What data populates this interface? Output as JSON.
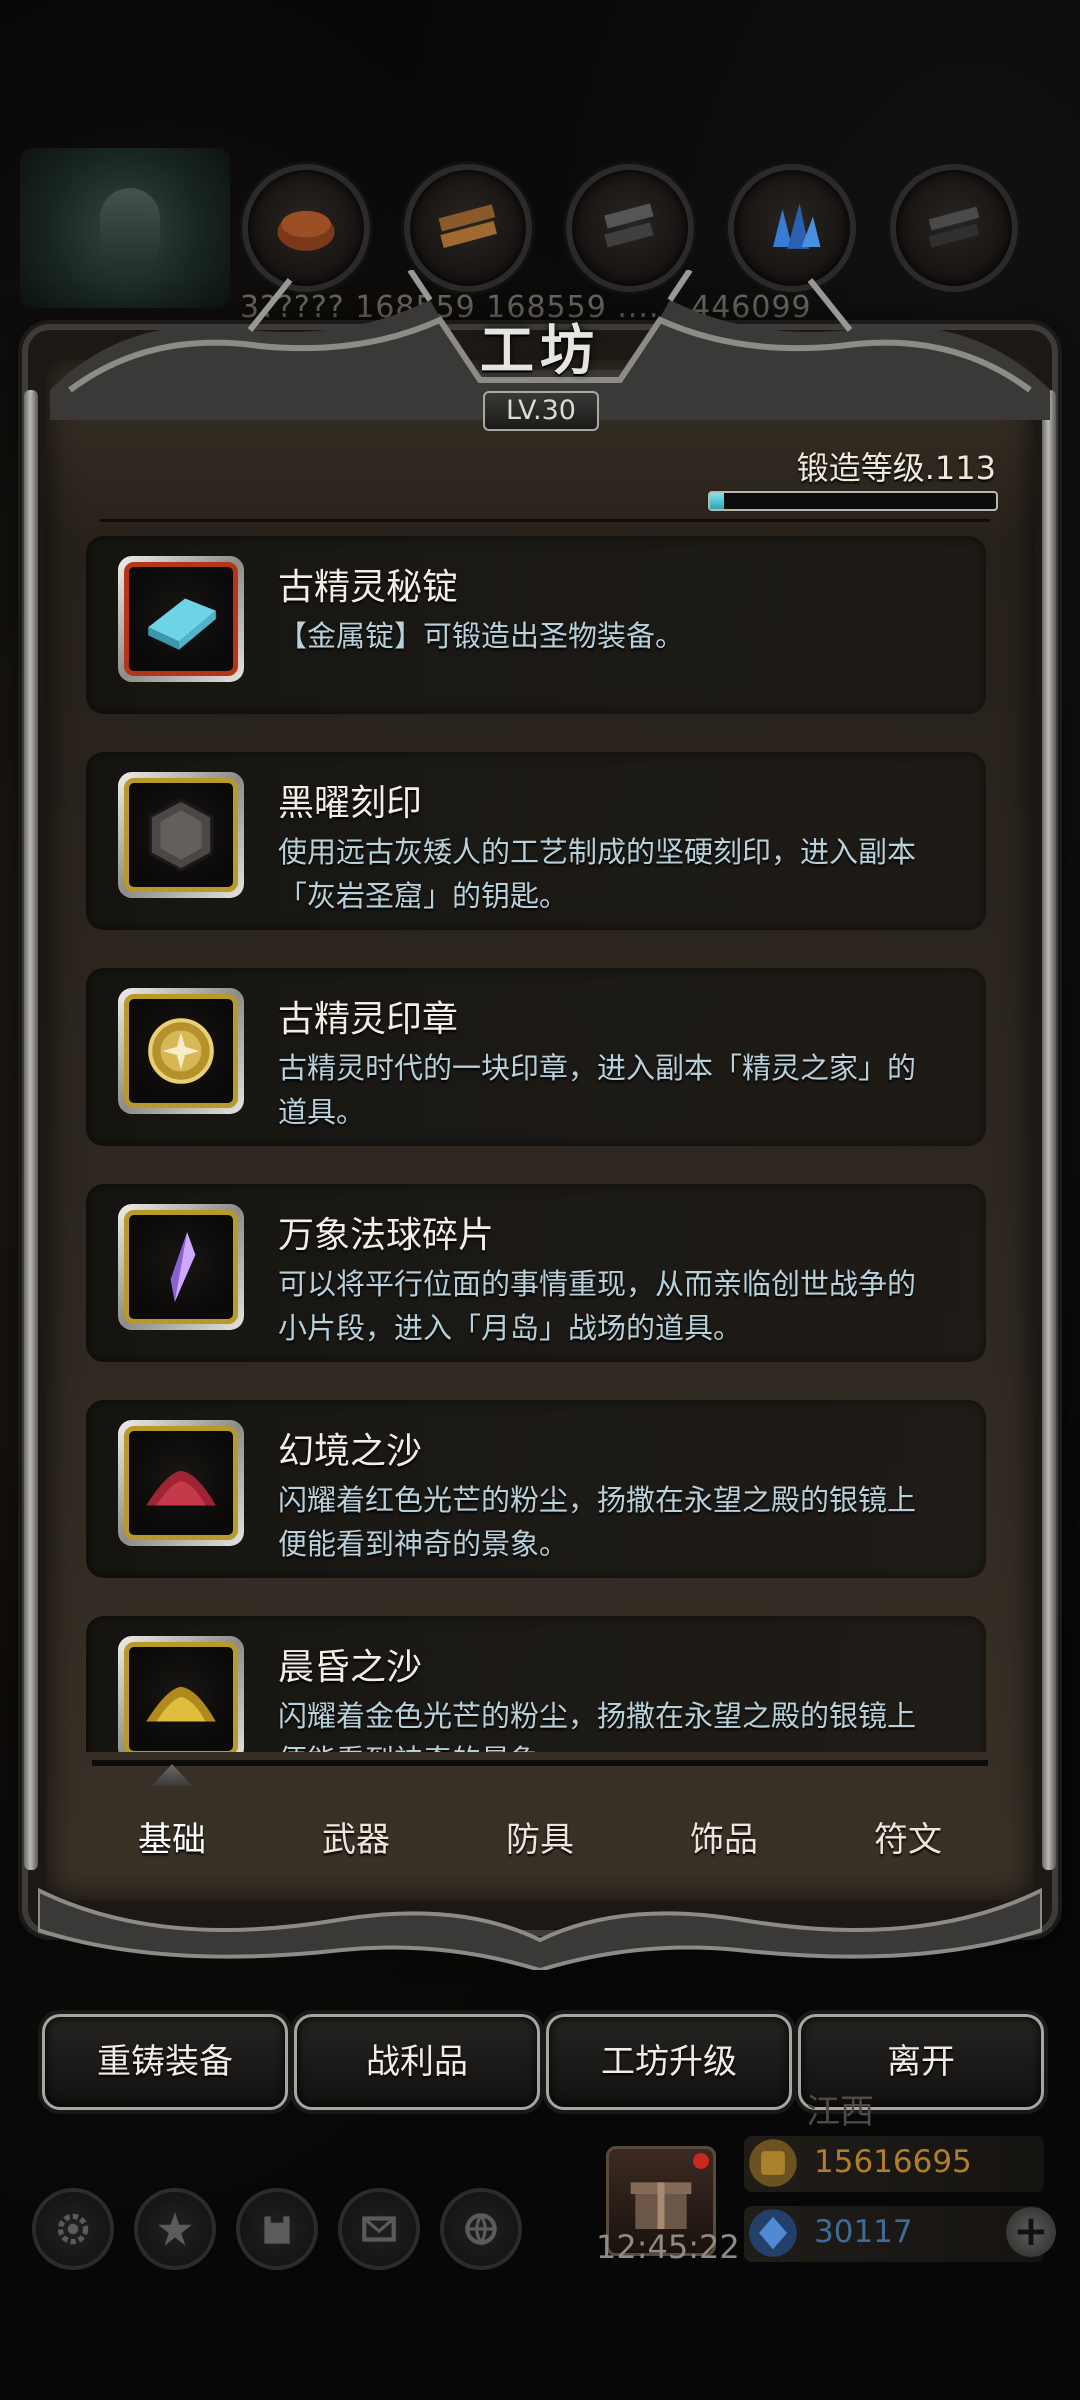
{
  "resources": {
    "counts_text": "3?????  168559  168559  ......  446099"
  },
  "workshop": {
    "title": "工坊",
    "level_badge": "LV.30",
    "forge_level_label": "锻造等级.113",
    "forge_progress": 0.05
  },
  "items": [
    {
      "name": "古精灵秘锭",
      "desc": "【金属锭】可锻造出圣物装备。",
      "icon": "ingot-icon",
      "rarity_color": "#b33618"
    },
    {
      "name": "黑曜刻印",
      "desc": "使用远古灰矮人的工艺制成的坚硬刻印，进入副本「灰岩圣窟」的钥匙。",
      "icon": "obsidian-seal-icon",
      "rarity_color": "#b89a2b"
    },
    {
      "name": "古精灵印章",
      "desc": "古精灵时代的一块印章，进入副本「精灵之家」的道具。",
      "icon": "elven-seal-icon",
      "rarity_color": "#b89a2b"
    },
    {
      "name": "万象法球碎片",
      "desc": "可以将平行位面的事情重现，从而亲临创世战争的小片段，进入「月岛」战场的道具。",
      "icon": "crystal-shard-icon",
      "rarity_color": "#b89a2b"
    },
    {
      "name": "幻境之沙",
      "desc": "闪耀着红色光芒的粉尘，扬撒在永望之殿的银镜上便能看到神奇的景象。",
      "icon": "red-sand-icon",
      "rarity_color": "#b89a2b"
    },
    {
      "name": "晨昏之沙",
      "desc": "闪耀着金色光芒的粉尘，扬撒在永望之殿的银镜上便能看到神奇的景象。",
      "icon": "gold-sand-icon",
      "rarity_color": "#b89a2b"
    }
  ],
  "tabs": [
    "基础",
    "武器",
    "防具",
    "饰品",
    "符文"
  ],
  "active_tab": 0,
  "actions": [
    "重铸装备",
    "战利品",
    "工坊升级",
    "离开"
  ],
  "hud": {
    "clock": "12:45:22",
    "region": "江西",
    "gold": "15616695",
    "gems": "30117",
    "plus_label": "+"
  },
  "colors": {
    "gold_text": "#b07d2a",
    "gem_text": "#3f6a9a",
    "progress_fill": "#2fa5b6"
  }
}
